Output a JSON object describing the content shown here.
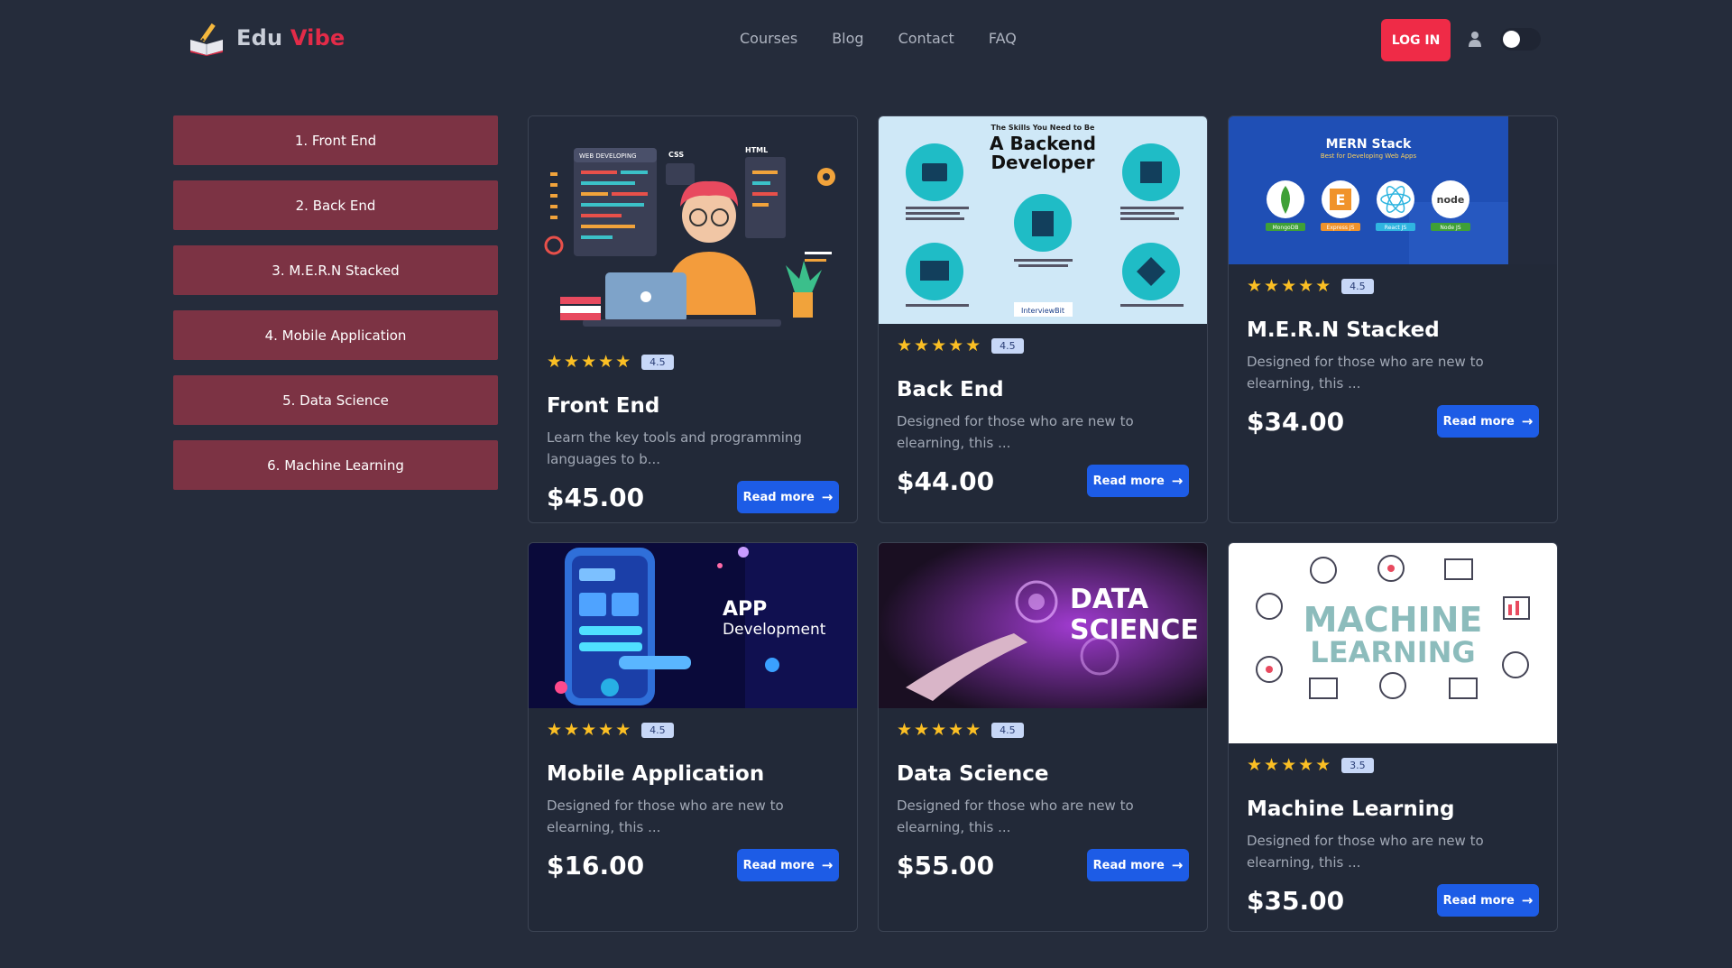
{
  "brand": {
    "first": "Edu",
    "second": "Vibe"
  },
  "nav": {
    "links": [
      "Courses",
      "Blog",
      "Contact",
      "FAQ"
    ],
    "login_label": "LOG IN"
  },
  "sidebar": {
    "items": [
      "1. Front End",
      "2. Back End",
      "3. M.E.R.N Stacked",
      "4. Mobile Application",
      "5. Data Science",
      "6. Machine Learning"
    ]
  },
  "colors": {
    "accent": "#ef2b47",
    "sidebar": "#7c3344",
    "button": "#1d5ce6",
    "background": "#252c3b"
  },
  "courses": [
    {
      "title": "Front End",
      "rating": "4.5",
      "stars": "★★★★★",
      "desc": "Learn the key tools and programming languages to b...",
      "price": "$45.00",
      "button": "Read more",
      "image": {
        "labels": [
          "WEB DEVELOPING",
          "CSS",
          "HTML"
        ]
      }
    },
    {
      "title": "Back End",
      "rating": "4.5",
      "stars": "★★★★★",
      "desc": "Designed for those who are new to elearning, this ...",
      "price": "$44.00",
      "button": "Read more",
      "image": {
        "labels": [
          "The Skills You Need to Be",
          "A Backend",
          "Developer",
          "InterviewBit"
        ]
      }
    },
    {
      "title": "M.E.R.N Stacked",
      "rating": "4.5",
      "stars": "★★★★★",
      "desc": "Designed for those who are new to elearning, this ...",
      "price": "$34.00",
      "button": "Read more",
      "image": {
        "labels": [
          "MERN Stack",
          "Best for Developing Web Apps",
          "MongoDB",
          "Express JS",
          "React JS",
          "Node JS"
        ]
      }
    },
    {
      "title": "Mobile Application",
      "rating": "4.5",
      "stars": "★★★★★",
      "desc": "Designed for those who are new to elearning, this ...",
      "price": "$16.00",
      "button": "Read more",
      "image": {
        "labels": [
          "APP",
          "Development"
        ]
      }
    },
    {
      "title": "Data Science",
      "rating": "4.5",
      "stars": "★★★★★",
      "desc": "Designed for those who are new to elearning, this ...",
      "price": "$55.00",
      "button": "Read more",
      "image": {
        "labels": [
          "DATA",
          "SCIENCE"
        ]
      }
    },
    {
      "title": "Machine Learning",
      "rating": "3.5",
      "stars": "★★★★★",
      "desc": "Designed for those who are new to elearning, this ...",
      "price": "$35.00",
      "button": "Read more",
      "image": {
        "labels": [
          "MACHINE",
          "LEARNING"
        ]
      }
    }
  ]
}
